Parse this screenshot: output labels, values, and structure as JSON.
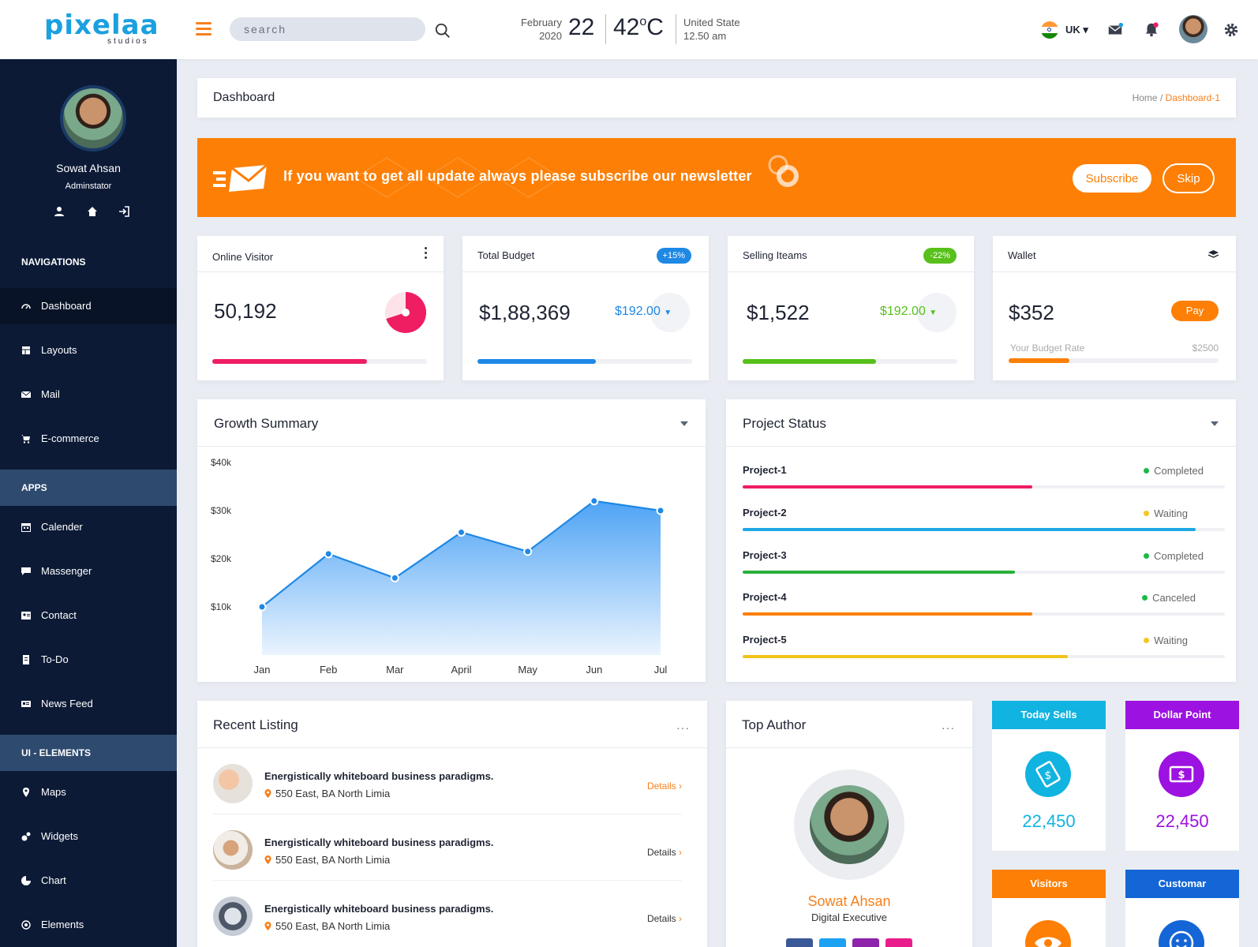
{
  "brand": {
    "name": "pixelaa",
    "sub": "studios"
  },
  "topbar": {
    "search_placeholder": "search",
    "date_month": "February",
    "date_year": "2020",
    "date_day": "22",
    "temperature": "42",
    "temperature_unit": "C",
    "location": "United State",
    "time": "12.50 am",
    "language": "UK"
  },
  "sidebar": {
    "user_name": "Sowat Ahsan",
    "user_role": "Adminstator",
    "sections": [
      {
        "title": "NAVIGATIONS",
        "items": [
          {
            "label": "Dashboard",
            "icon": "gauge-icon",
            "active": true
          },
          {
            "label": "Layouts",
            "icon": "layout-icon"
          },
          {
            "label": "Mail",
            "icon": "mail-icon"
          },
          {
            "label": "E-commerce",
            "icon": "cart-icon"
          }
        ]
      },
      {
        "title": "APPS",
        "items": [
          {
            "label": "Calender",
            "icon": "calendar-icon"
          },
          {
            "label": "Massenger",
            "icon": "chat-icon"
          },
          {
            "label": "Contact",
            "icon": "contact-icon"
          },
          {
            "label": "To-Do",
            "icon": "todo-icon"
          },
          {
            "label": "News Feed",
            "icon": "news-icon"
          }
        ]
      },
      {
        "title": "UI - ELEMENTS",
        "items": [
          {
            "label": "Maps",
            "icon": "map-pin-icon"
          },
          {
            "label": "Widgets",
            "icon": "widgets-icon"
          },
          {
            "label": "Chart",
            "icon": "pie-chart-icon"
          },
          {
            "label": "Elements",
            "icon": "elements-icon"
          }
        ]
      }
    ]
  },
  "page": {
    "title": "Dashboard",
    "breadcrumb_home": "Home",
    "breadcrumb_sep": " / ",
    "breadcrumb_current": "Dashboard-1"
  },
  "banner": {
    "text": "If you want to get all update always please subscribe our newsletter",
    "subscribe": "Subscribe",
    "skip": "Skip"
  },
  "stats": {
    "visitor": {
      "label": "Online Visitor",
      "value": "50,192",
      "progress": 0.72,
      "donut_fraction": 0.7
    },
    "budget": {
      "label": "Total Budget",
      "badge": "+15%",
      "value": "$1,88,369",
      "delta": "$192.00",
      "progress": 0.55
    },
    "selling": {
      "label": "Selling Iteams",
      "badge": "-22%",
      "value": "$1,522",
      "delta": "$192.00",
      "progress": 0.62
    },
    "wallet": {
      "label": "Wallet",
      "value": "$352",
      "pay": "Pay",
      "rate_label": "Your Budget Rate",
      "rate_value": "$2500",
      "progress": 0.29
    }
  },
  "growth": {
    "title": "Growth Summary"
  },
  "chart_data": {
    "type": "area",
    "title": "Growth Summary",
    "categories": [
      "Jan",
      "Feb",
      "Mar",
      "April",
      "May",
      "Jun",
      "Jul"
    ],
    "values": [
      10000,
      21000,
      16000,
      25500,
      21500,
      32000,
      30000
    ],
    "y_ticks": [
      "$10k",
      "$20k",
      "$30k",
      "$40k"
    ],
    "ylim": [
      0,
      40000
    ],
    "color": "#1e88e5"
  },
  "projects": {
    "title": "Project Status",
    "items": [
      {
        "name": "Project-1",
        "status": "Completed",
        "dot": "#1db84a",
        "progress": 0.6,
        "color": "#ef1d62"
      },
      {
        "name": "Project-2",
        "status": "Waiting",
        "dot": "#f3c623",
        "progress": 0.94,
        "color": "#1ea7e4"
      },
      {
        "name": "Project-3",
        "status": "Completed",
        "dot": "#1db84a",
        "progress": 0.565,
        "color": "#2ab13a"
      },
      {
        "name": "Project-4",
        "status": "Canceled",
        "dot": "#1db84a",
        "progress": 0.6,
        "color": "#fd7f05"
      },
      {
        "name": "Project-5",
        "status": "Waiting",
        "dot": "#f3c623",
        "progress": 0.675,
        "color": "#f0c419"
      }
    ]
  },
  "listing": {
    "title": "Recent Listing",
    "items": [
      {
        "title": "Energistically whiteboard business paradigms.",
        "address": "550 East, BA North Limia",
        "details": "Details"
      },
      {
        "title": "Energistically whiteboard business paradigms.",
        "address": "550 East, BA North Limia",
        "details": "Details"
      },
      {
        "title": "Energistically whiteboard business paradigms.",
        "address": "550 East, BA North Limia",
        "details": "Details"
      }
    ]
  },
  "author": {
    "title": "Top Author",
    "name": "Sowat Ahsan",
    "role": "Digital Executive"
  },
  "minis": {
    "today_sells": {
      "label": "Today Sells",
      "value": "22,450",
      "color": "#11b3e0"
    },
    "dollar_point": {
      "label": "Dollar Point",
      "value": "22,450",
      "color": "#9c12e0"
    },
    "visitors": {
      "label": "Visitors",
      "color": "#fd7f05"
    },
    "customar": {
      "label": "Customar",
      "color": "#1466d6"
    }
  }
}
